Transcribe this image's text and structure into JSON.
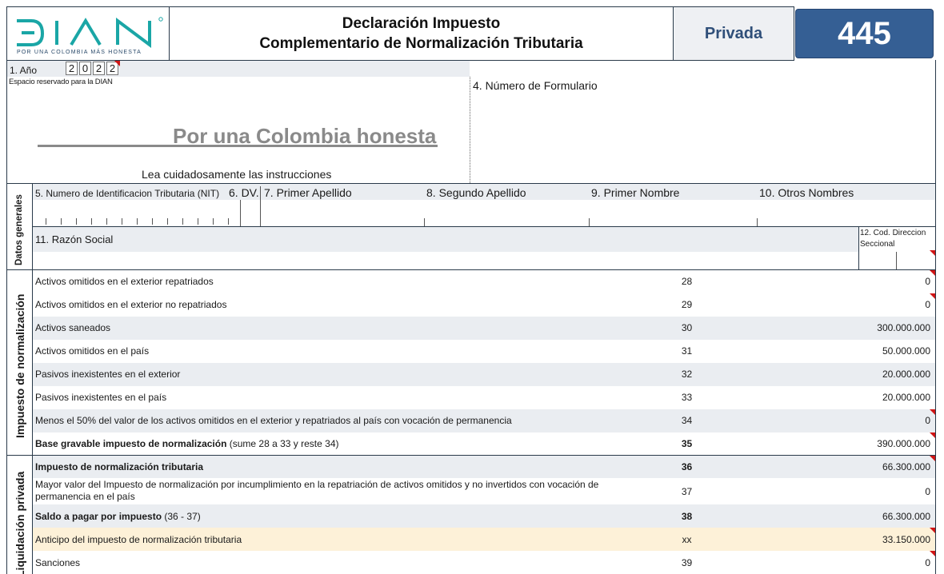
{
  "header": {
    "logo_text": "DIAN",
    "logo_tagline": "POR UNA COLOMBIA MÁS HONESTA",
    "title_line1": "Declaración Impuesto",
    "title_line2": "Complementario de Normalización Tributaria",
    "privada": "Privada",
    "form_number": "445"
  },
  "top": {
    "anio_label": "1. Año",
    "anio_digits": [
      "2",
      "0",
      "2",
      "2"
    ],
    "reservado": "Espacio reservado para la DIAN",
    "slogan": "Por una Colombia honesta",
    "instrucciones": "Lea cuidadosamente las instrucciones",
    "numero_formulario": "4. Número de Formulario"
  },
  "datos_generales": {
    "section_label": "Datos generales",
    "nit": "5. Numero de Identificacion Tributaria (NIT)",
    "dv": "6. DV.",
    "primer_apellido": "7. Primer Apellido",
    "segundo_apellido": "8. Segundo Apellido",
    "primer_nombre": "9. Primer Nombre",
    "otros_nombres": "10. Otros Nombres",
    "razon_social": "11.  Razón Social",
    "cod_direccion_1": "12. Cod. Direccion",
    "cod_direccion_2": "Seccional"
  },
  "impuesto": {
    "section_label": "Impuesto de normalización",
    "rows": [
      {
        "desc": "Activos omitidos en el exterior repatriados",
        "num": "28",
        "val": "0"
      },
      {
        "desc": "Activos omitidos en el exterior no repatriados",
        "num": "29",
        "val": "0"
      },
      {
        "desc": "Activos saneados",
        "num": "30",
        "val": "300.000.000"
      },
      {
        "desc": "Activos omitidos en el país",
        "num": "31",
        "val": "50.000.000"
      },
      {
        "desc": "Pasivos inexistentes en el exterior",
        "num": "32",
        "val": "20.000.000"
      },
      {
        "desc": "Pasivos inexistentes en el país",
        "num": "33",
        "val": "20.000.000"
      },
      {
        "desc": "Menos el 50% del valor de los activos omitidos en el exterior y repatriados al país con vocación de permanencia",
        "num": "34",
        "val": "0"
      },
      {
        "desc_bold": "Base gravable impuesto de normalización",
        "desc_rest": " (sume 28 a 33 y reste 34)",
        "num": "35",
        "val": "390.000.000"
      }
    ]
  },
  "liquidacion": {
    "section_label": "Liquidación privada",
    "rows": [
      {
        "desc_bold": "Impuesto de normalización tributaria",
        "num": "36",
        "val": "66.300.000"
      },
      {
        "desc": "Mayor valor del Impuesto de normalización por incumplimiento en la repatriación de activos omitidos y no invertidos con vocación de permanencia en el país",
        "num": "37",
        "val": "0"
      },
      {
        "desc_bold": "Saldo a pagar por impuesto",
        "desc_rest": " (36 - 37)",
        "num": "38",
        "val": "66.300.000"
      },
      {
        "desc": "Anticipo del impuesto de normalización tributaria",
        "num": "xx",
        "val": "33.150.000"
      },
      {
        "desc": "Sanciones",
        "num": "39",
        "val": "0"
      }
    ]
  },
  "colors": {
    "form_number_bg": "#355f94",
    "privada_text": "#2f4f79",
    "row_shade": "#eaedf1",
    "anticipo_shade": "#fdf1d8",
    "red_marker": "#d01515",
    "logo_teal": "#1aa6a6"
  }
}
